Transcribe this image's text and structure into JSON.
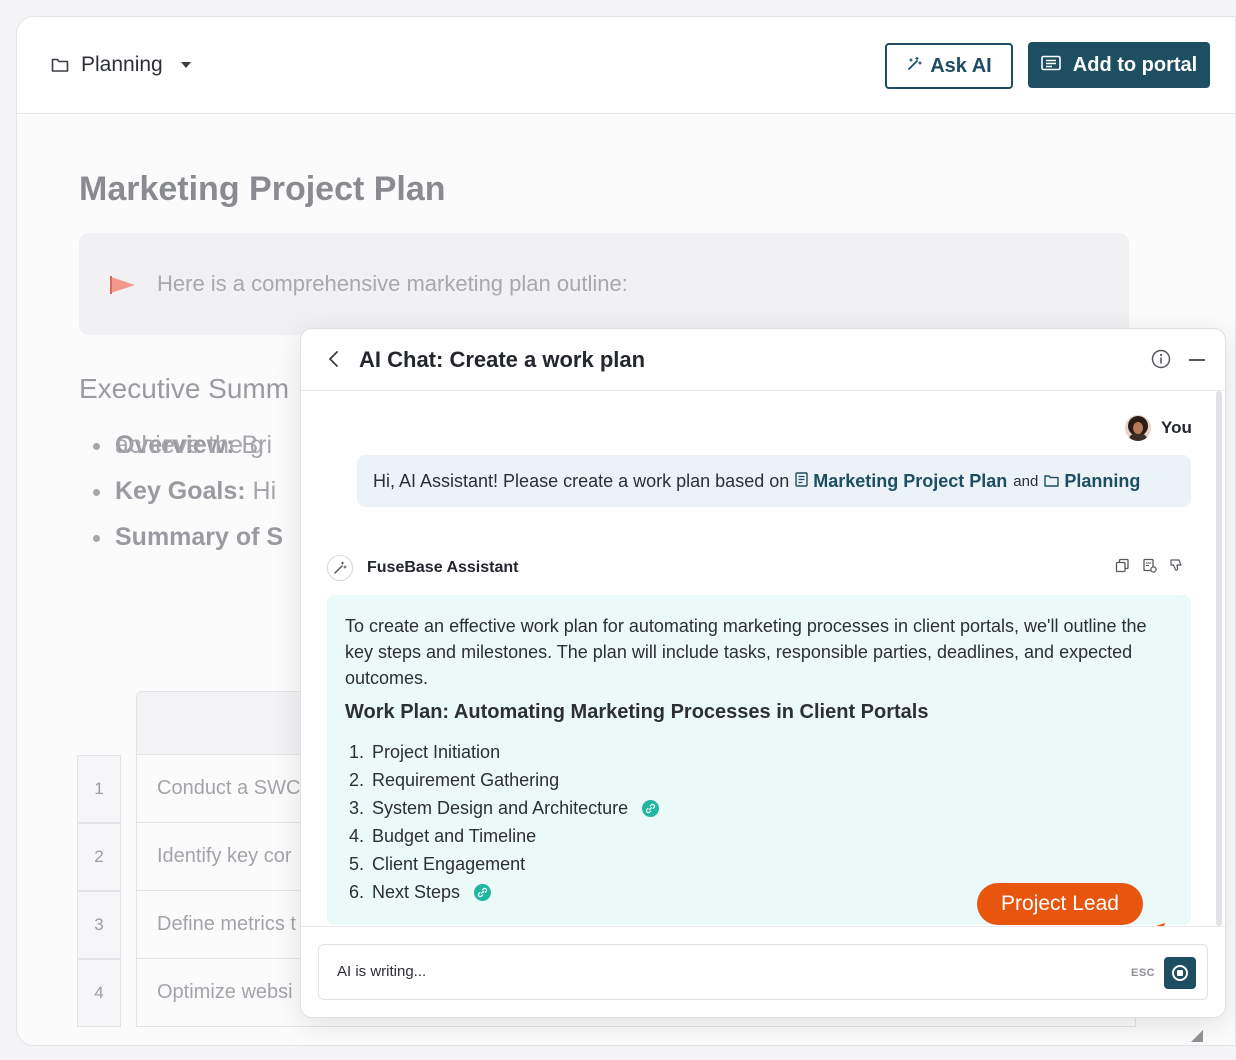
{
  "header": {
    "folder_label": "Planning",
    "ask_ai_label": "Ask AI",
    "add_portal_label": "Add to portal"
  },
  "document": {
    "title": "Marketing Project Plan",
    "callout_text": "Here is a comprehensive marketing plan outline:",
    "section_heading": "Executive Summ",
    "bullets": [
      {
        "bold": "Overview:",
        "rest": " Bri"
      },
      {
        "bold": "Key Goals:",
        "rest": " Hi"
      },
      {
        "bold": "Summary of S",
        "rest": ""
      }
    ],
    "bullet_continuation": "achieve the g",
    "table_rows": [
      {
        "num": "1",
        "text": "Conduct a SWC"
      },
      {
        "num": "2",
        "text": "Identify key cor"
      },
      {
        "num": "3",
        "text": "Define metrics t"
      },
      {
        "num": "4",
        "text": "Optimize websi"
      }
    ]
  },
  "chat": {
    "title": "AI Chat: Create a work plan",
    "user_label": "You",
    "user_message_prefix": "Hi, AI Assistant! Please create a work plan based on",
    "user_ref_doc": "Marketing Project Plan",
    "user_message_and": "and",
    "user_ref_folder": "Planning",
    "assistant_label": "FuseBase Assistant",
    "assistant_intro": "To create an effective work plan for automating marketing processes in client portals, we'll outline the key steps and milestones. The plan will include tasks, responsible parties, deadlines, and expected outcomes.",
    "assistant_heading": "Work Plan: Automating Marketing Processes in Client Portals",
    "plan_items": [
      {
        "num": "1.",
        "label": "Project Initiation"
      },
      {
        "num": "2.",
        "label": "Requirement Gathering"
      },
      {
        "num": "3.",
        "label": "System Design and Architecture"
      },
      {
        "num": "4.",
        "label": "Budget and Timeline"
      },
      {
        "num": "5.",
        "label": "Client Engagement"
      },
      {
        "num": "6.",
        "label": "Next Steps"
      }
    ],
    "project_lead_tag": "Project Lead",
    "composer_status": "AI is writing...",
    "esc_hint": "ESC"
  },
  "colors": {
    "brand": "#1d4e61",
    "accent_orange": "#e8550e",
    "link_teal": "#21b6a0",
    "assistant_bubble": "#ebfaf8",
    "user_bubble": "#ebf3f8"
  }
}
